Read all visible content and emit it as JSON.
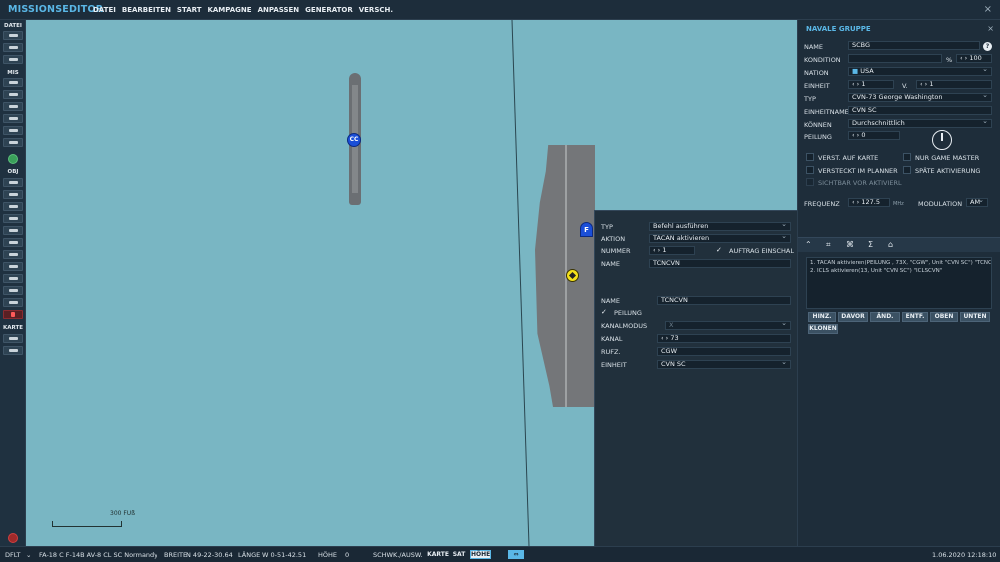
{
  "app": {
    "title": "MISSIONSEDITOR",
    "menu": [
      "DATEI",
      "BEARBEITEN",
      "START",
      "KAMPAGNE",
      "ANPASSEN",
      "GENERATOR",
      "VERSCH."
    ],
    "close_icon": "×"
  },
  "left_toolbar": {
    "sections": [
      "DATEI",
      "MIS",
      "OBJ",
      "KARTE"
    ]
  },
  "map": {
    "markers": {
      "cc": "CC",
      "f": "F"
    },
    "scale_label": "300 FUß"
  },
  "task_panel": {
    "typ_label": "TYP",
    "typ_value": "Befehl ausführen",
    "aktion_label": "AKTION",
    "aktion_value": "TACAN aktivieren",
    "nummer_label": "NUMMER",
    "nummer_value": "1",
    "auftrag_label": "AUFTRAG EINSCHAL",
    "name_label": "NAME",
    "name_value": "TCNCVN",
    "name2_label": "NAME",
    "name2_value": "TCNCVN",
    "peilung_label": "PEILUNG",
    "kanalmodus_label": "KANALMODUS",
    "kanalmodus_value": "X",
    "kanal_label": "KANAL",
    "kanal_value": "73",
    "rufz_label": "RUFZ.",
    "rufz_value": "CGW",
    "einheit_label": "EINHEIT",
    "einheit_value": "CVN SC"
  },
  "right_panel": {
    "title": "NAVALE GRUPPE",
    "name_label": "NAME",
    "name_value": "SCBG",
    "help": "?",
    "kondition_label": "KONDITION",
    "kondition_unit": "%",
    "kondition_value": "100",
    "nation_label": "NATION",
    "nation_value": "USA",
    "einheit_label": "EINHEIT",
    "einheit_value": "1",
    "einheit_of": "V.",
    "einheit_total": "1",
    "typ_label": "TYP",
    "typ_value": "CVN-73 George Washington",
    "einheitname_label": "EINHEITNAME",
    "einheitname_value": "CVN SC",
    "koennen_label": "KÖNNEN",
    "koennen_value": "Durchschnittlich",
    "peilung_label": "PEILUNG",
    "peilung_value": "0",
    "checks": {
      "verst": "VERST. AUF KARTE",
      "nur_gm": "NUR GAME MASTER",
      "versteckt": "VERSTECKT IM PLANNER",
      "spaete": "SPÄTE AKTIVIERUNG",
      "sichtbar": "SICHTBAR VOR AKTIVIERL"
    },
    "frequenz_label": "FREQUENZ",
    "frequenz_value": "127.5",
    "frequenz_unit": "MHz",
    "modulation_label": "MODULATION",
    "modulation_value": "AM",
    "actions": [
      "1. TACAN aktivieren(PEILUNG , 73X, \"CGW\", Unit \"CVN SC\")  \"TCNCVN\"",
      "2. ICLS aktivieren(13, Unit \"CVN SC\")  \"ICLSCVN\""
    ],
    "buttons": {
      "hinz": "HINZ.",
      "davor": "DAVOR",
      "aend": "ÄND.",
      "entf": "ENTF.",
      "oben": "OBEN",
      "unten": "UNTEN",
      "klonen": "KLONEN"
    }
  },
  "statusbar": {
    "profile": "DFLT",
    "aircraft": "FA-18 C F-14B AV-8 CL SC Normandy.n",
    "breite_label": "BREITE",
    "breite_value": "N 49-22-30.64",
    "laenge_label": "LÄNGE",
    "laenge_value": "W  0-51-42.51",
    "hoehe_label": "HÖHE",
    "hoehe_value": "0",
    "schwk_label": "SCHWK./AUSW.",
    "karte": "KARTE",
    "sat": "SAT",
    "hoehe_btn": "HÖHE",
    "datetime": "1.06.2020 12:18:10"
  }
}
